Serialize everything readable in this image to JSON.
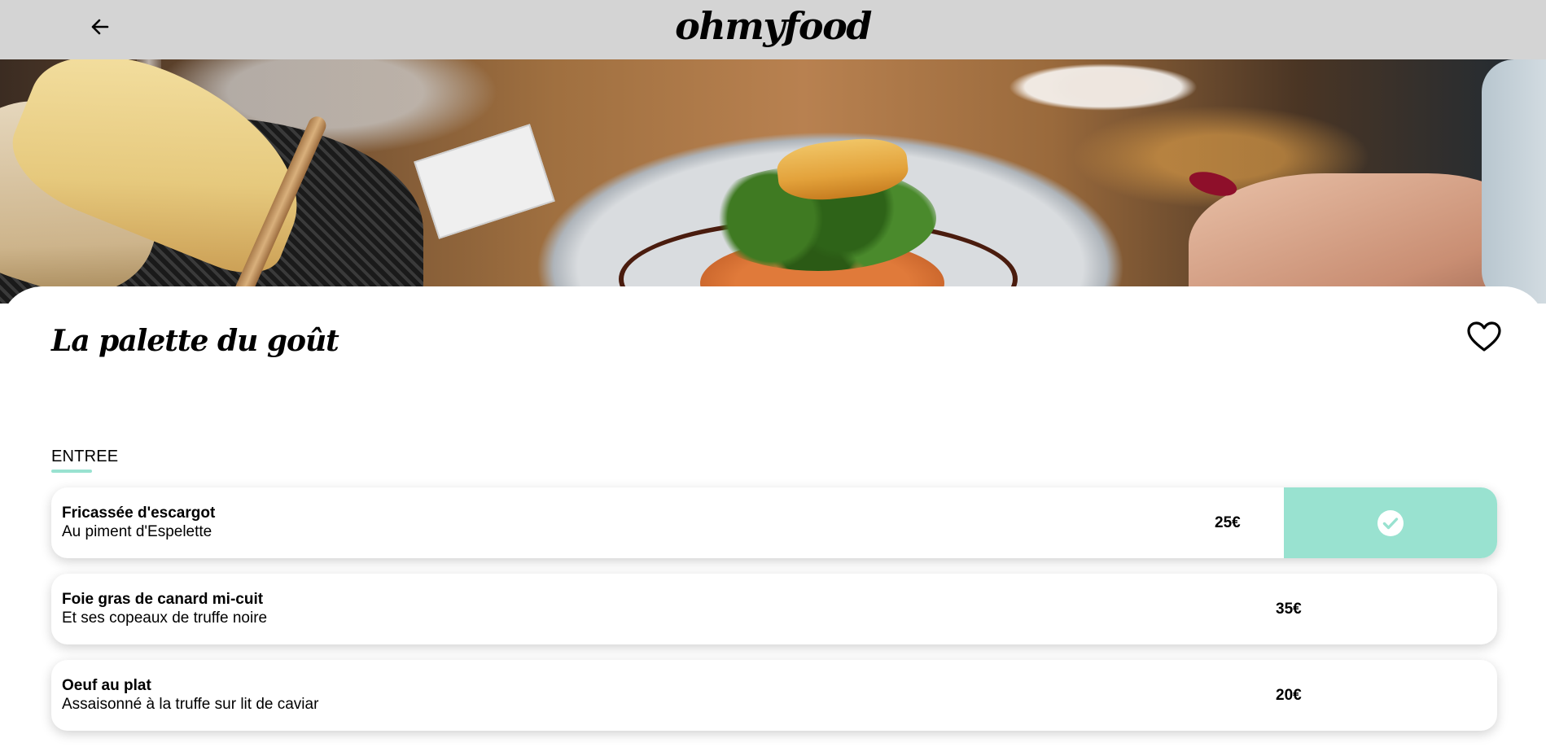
{
  "header": {
    "back_icon": "arrow-left-icon",
    "logo": "ohmyfood"
  },
  "hero": {
    "image": "plated-fish-dish-photo"
  },
  "restaurant": {
    "name": "La palette du goût",
    "favorite_icon": "heart-outline-icon"
  },
  "menu": {
    "section_label": "ENTREE",
    "accent_color": "#99e2d0",
    "items": [
      {
        "name": "Fricassée d'escargot",
        "description": "Au piment d'Espelette",
        "price": "25€",
        "selected": true,
        "check_icon": "check-circle-icon"
      },
      {
        "name": "Foie gras de canard mi-cuit",
        "description": "Et ses copeaux de truffe noire",
        "price": "35€",
        "selected": false
      },
      {
        "name": "Oeuf au plat",
        "description": "Assaisonné à la truffe sur lit de caviar",
        "price": "20€",
        "selected": false
      }
    ]
  }
}
